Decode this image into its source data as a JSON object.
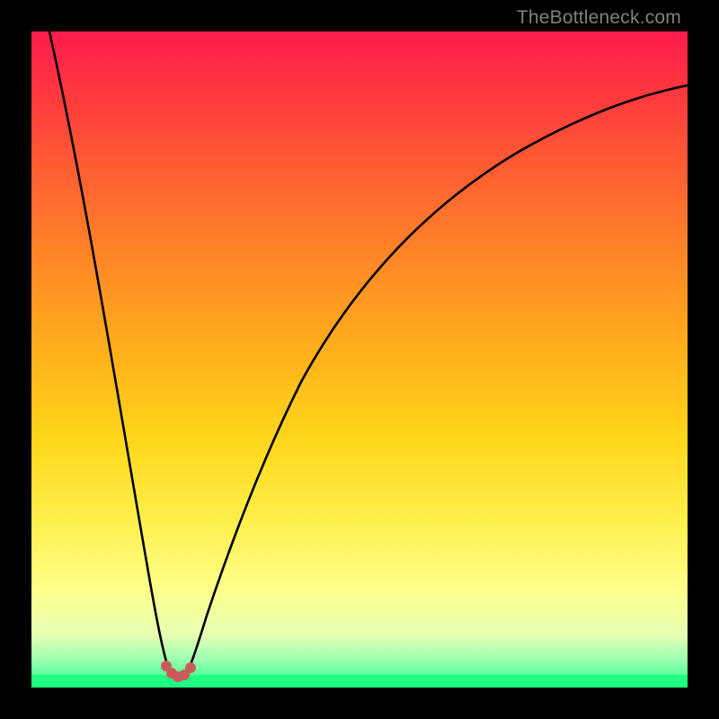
{
  "watermark": "TheBottleneck.com",
  "chart_data": {
    "type": "line",
    "title": "",
    "xlabel": "",
    "ylabel": "",
    "xlim": [
      0,
      100
    ],
    "ylim": [
      0,
      100
    ],
    "grid": false,
    "left_branch": {
      "x": [
        2,
        5,
        8,
        11,
        14,
        16,
        18,
        19,
        20,
        21
      ],
      "y": [
        100,
        80,
        60,
        42,
        26,
        15,
        7,
        3,
        1,
        0
      ]
    },
    "right_branch": {
      "x": [
        23,
        24,
        26,
        30,
        35,
        42,
        50,
        60,
        72,
        85,
        100
      ],
      "y": [
        0,
        2,
        8,
        22,
        38,
        54,
        66,
        75,
        82,
        87,
        90
      ]
    },
    "valley_markers": {
      "x": [
        19.5,
        20.5,
        21.5,
        22.5,
        23.5
      ],
      "y": [
        2,
        0.5,
        0,
        0.5,
        2
      ]
    },
    "background": "vertical heat gradient red to yellow to green",
    "description": "Bottleneck curve showing optimum near x≈22 where curve reaches the green (optimal) zone; red indicates high bottleneck, green indicates balanced performance."
  }
}
